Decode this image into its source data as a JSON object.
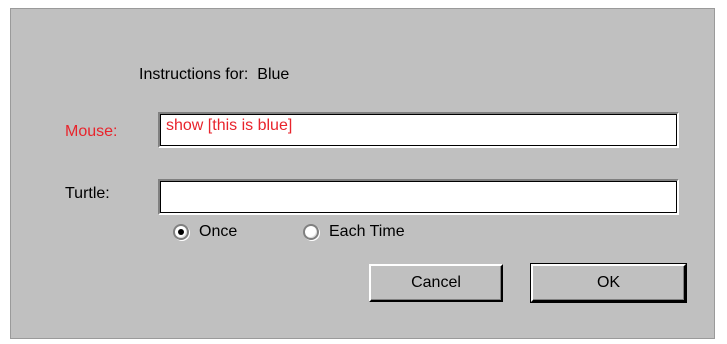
{
  "dialog": {
    "instructions_label": "Instructions for:",
    "target_name": "Blue",
    "mouse": {
      "label": "Mouse:",
      "value": "show [this is blue]",
      "label_color": "#e8242c"
    },
    "turtle": {
      "label": "Turtle:",
      "value": ""
    },
    "run_mode": {
      "options": [
        "Once",
        "Each Time"
      ],
      "selected": "Once"
    },
    "buttons": {
      "cancel": "Cancel",
      "ok": "OK"
    }
  }
}
